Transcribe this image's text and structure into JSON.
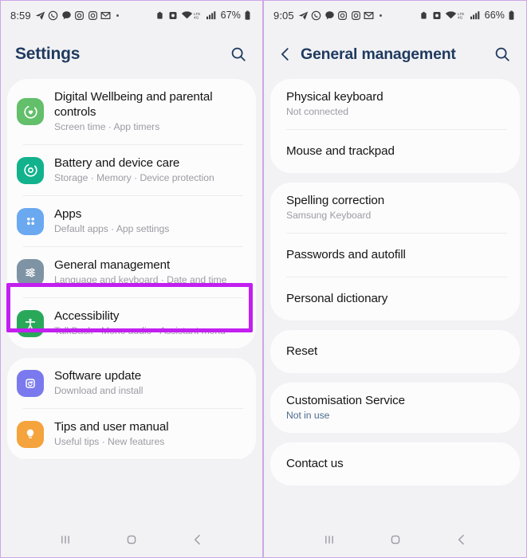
{
  "left_phone": {
    "status_bar": {
      "time": "8:59",
      "left_icons": [
        "telegram-icon",
        "whatsapp-icon",
        "chat-icon",
        "instagram-icon",
        "instagram-alt-icon",
        "gmail-icon",
        "more-dot-icon"
      ],
      "right_icons": [
        "alarm-icon",
        "dnd-icon",
        "wifi-icon",
        "lte-icon",
        "signal-icon"
      ],
      "battery_percent": "67%"
    },
    "header": {
      "title": "Settings",
      "search_icon": "search-icon"
    },
    "groups": [
      {
        "items": [
          {
            "title": "Digital Wellbeing and parental controls",
            "subtitle": "Screen time  ·  App timers",
            "icon": "digital-wellbeing-icon",
            "icon_color": "#63bf6a"
          },
          {
            "title": "Battery and device care",
            "subtitle": "Storage  ·  Memory  ·  Device protection",
            "icon": "device-care-icon",
            "icon_color": "#12b28c"
          },
          {
            "title": "Apps",
            "subtitle": "Default apps  ·  App settings",
            "icon": "apps-icon",
            "icon_color": "#6aa9f0"
          },
          {
            "title": "General management",
            "subtitle": "Language and keyboard  ·  Date and time",
            "icon": "sliders-icon",
            "icon_color": "#7e94a5",
            "highlighted": true
          },
          {
            "title": "Accessibility",
            "subtitle": "TalkBack  ·  Mono audio  ·  Assistant menu",
            "icon": "accessibility-icon",
            "icon_color": "#2aa85a"
          }
        ]
      },
      {
        "items": [
          {
            "title": "Software update",
            "subtitle": "Download and install",
            "icon": "software-update-icon",
            "icon_color": "#7a7aee"
          },
          {
            "title": "Tips and user manual",
            "subtitle": "Useful tips  ·  New features",
            "icon": "lightbulb-icon",
            "icon_color": "#f5a33c"
          }
        ]
      }
    ],
    "nav_bar": [
      "recents-icon",
      "home-icon",
      "back-icon"
    ]
  },
  "right_phone": {
    "status_bar": {
      "time": "9:05",
      "left_icons": [
        "telegram-icon",
        "whatsapp-icon",
        "chat-icon",
        "instagram-icon",
        "instagram-alt-icon",
        "gmail-icon",
        "more-dot-icon"
      ],
      "right_icons": [
        "alarm-icon",
        "dnd-icon",
        "wifi-icon",
        "lte-icon",
        "signal-icon"
      ],
      "battery_percent": "66%"
    },
    "header": {
      "back_icon": "back-chevron-icon",
      "title": "General management",
      "search_icon": "search-icon"
    },
    "groups": [
      {
        "items": [
          {
            "title": "Physical keyboard",
            "subtitle": "Not connected"
          },
          {
            "title": "Mouse and trackpad",
            "subtitle": ""
          }
        ]
      },
      {
        "items": [
          {
            "title": "Spelling correction",
            "subtitle": "Samsung Keyboard"
          },
          {
            "title": "Passwords and autofill",
            "subtitle": ""
          },
          {
            "title": "Personal dictionary",
            "subtitle": ""
          }
        ]
      },
      {
        "items": [
          {
            "title": "Reset",
            "subtitle": "",
            "annotated": true
          }
        ]
      },
      {
        "items": [
          {
            "title": "Customisation Service",
            "subtitle": "Not in use",
            "subtitle_style": "blue"
          }
        ]
      },
      {
        "items": [
          {
            "title": "Contact us",
            "subtitle": ""
          }
        ]
      }
    ],
    "nav_bar": [
      "recents-icon",
      "home-icon",
      "back-icon"
    ]
  },
  "annotations": {
    "highlight_color": "#c21ff0",
    "arrow_color": "#c21ff0",
    "highlight_target": "General management",
    "arrow_target": "Reset"
  }
}
